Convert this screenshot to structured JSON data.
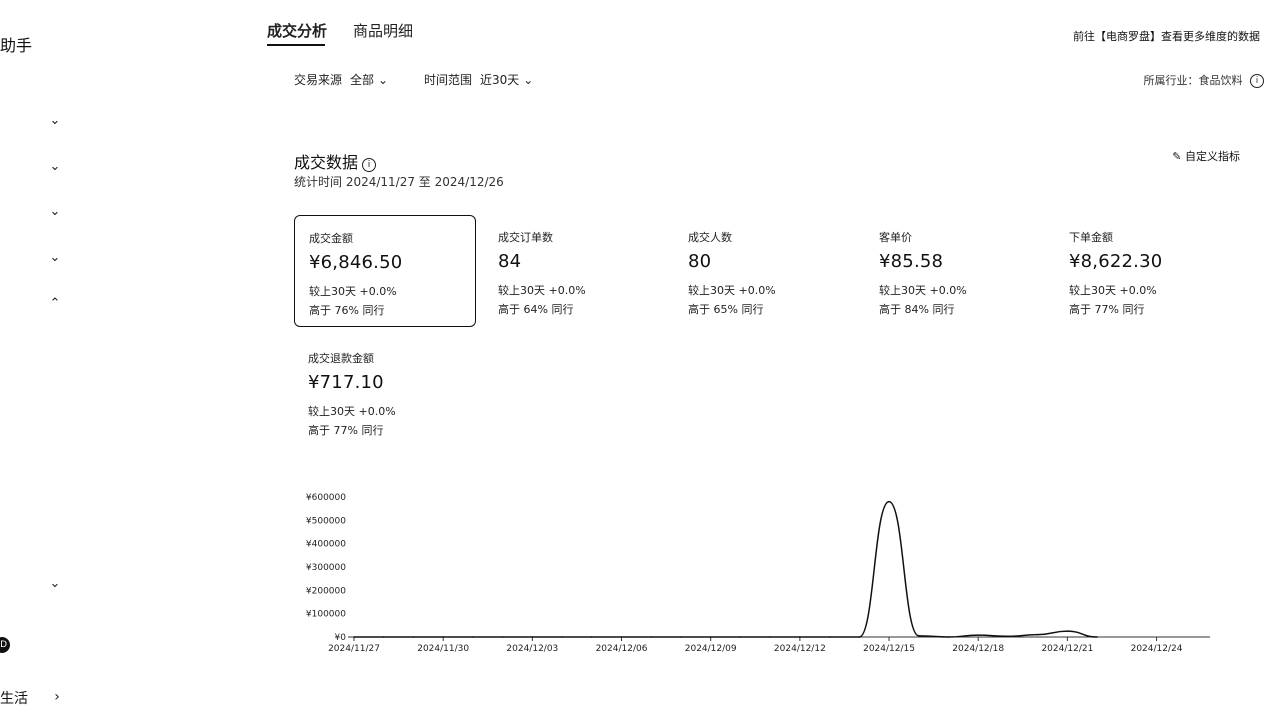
{
  "sidebar": {
    "title": "助手",
    "bottom_label": "生活",
    "badge": "D"
  },
  "tabs": [
    {
      "label": "成交分析",
      "active": true
    },
    {
      "label": "商品明细",
      "active": false
    }
  ],
  "header": {
    "right_link": "前往【电商罗盘】查看更多维度的数据"
  },
  "filters": {
    "source_label": "交易来源",
    "source_value": "全部",
    "range_label": "时间范围",
    "range_value": "近30天",
    "industry": "所属行业：食品饮料"
  },
  "section": {
    "title": "成交数据",
    "stat_time": "统计时间 2024/11/27 至 2024/12/26",
    "custom_button": "自定义指标"
  },
  "metrics": [
    {
      "name": "成交金额",
      "value": "¥6,846.50",
      "compare": "较上30天 +0.0%",
      "peer": "高于 76% 同行",
      "selected": true
    },
    {
      "name": "成交订单数",
      "value": "84",
      "compare": "较上30天 +0.0%",
      "peer": "高于 64% 同行"
    },
    {
      "name": "成交人数",
      "value": "80",
      "compare": "较上30天 +0.0%",
      "peer": "高于 65% 同行"
    },
    {
      "name": "客单价",
      "value": "¥85.58",
      "compare": "较上30天 +0.0%",
      "peer": "高于 84% 同行"
    },
    {
      "name": "下单金额",
      "value": "¥8,622.30",
      "compare": "较上30天 +0.0%",
      "peer": "高于 77% 同行"
    },
    {
      "name": "成交退款金额",
      "value": "¥717.10",
      "compare": "较上30天 +0.0%",
      "peer": "高于 77% 同行"
    }
  ],
  "chart_data": {
    "type": "line",
    "title": "",
    "xlabel": "",
    "ylabel": "",
    "ylim": [
      0,
      600000
    ],
    "y_ticks": [
      "¥0",
      "¥100000",
      "¥200000",
      "¥300000",
      "¥400000",
      "¥500000",
      "¥600000"
    ],
    "x_ticks": [
      "2024/11/27",
      "2024/11/30",
      "2024/12/03",
      "2024/12/06",
      "2024/12/09",
      "2024/12/12",
      "2024/12/15",
      "2024/12/18",
      "2024/12/21",
      "2024/12/24"
    ],
    "x": [
      "2024/11/27",
      "2024/11/28",
      "2024/11/29",
      "2024/11/30",
      "2024/12/01",
      "2024/12/02",
      "2024/12/03",
      "2024/12/04",
      "2024/12/05",
      "2024/12/06",
      "2024/12/07",
      "2024/12/08",
      "2024/12/09",
      "2024/12/10",
      "2024/12/11",
      "2024/12/12",
      "2024/12/13",
      "2024/12/14",
      "2024/12/15",
      "2024/12/16",
      "2024/12/17",
      "2024/12/18",
      "2024/12/19",
      "2024/12/20",
      "2024/12/21",
      "2024/12/22"
    ],
    "series": [
      {
        "values": [
          0,
          0,
          0,
          0,
          0,
          0,
          0,
          0,
          0,
          0,
          0,
          0,
          0,
          0,
          0,
          0,
          0,
          0,
          580000,
          5000,
          0,
          8000,
          3000,
          10000,
          25000,
          0
        ],
        "color": "#111111"
      }
    ],
    "grid": false
  }
}
